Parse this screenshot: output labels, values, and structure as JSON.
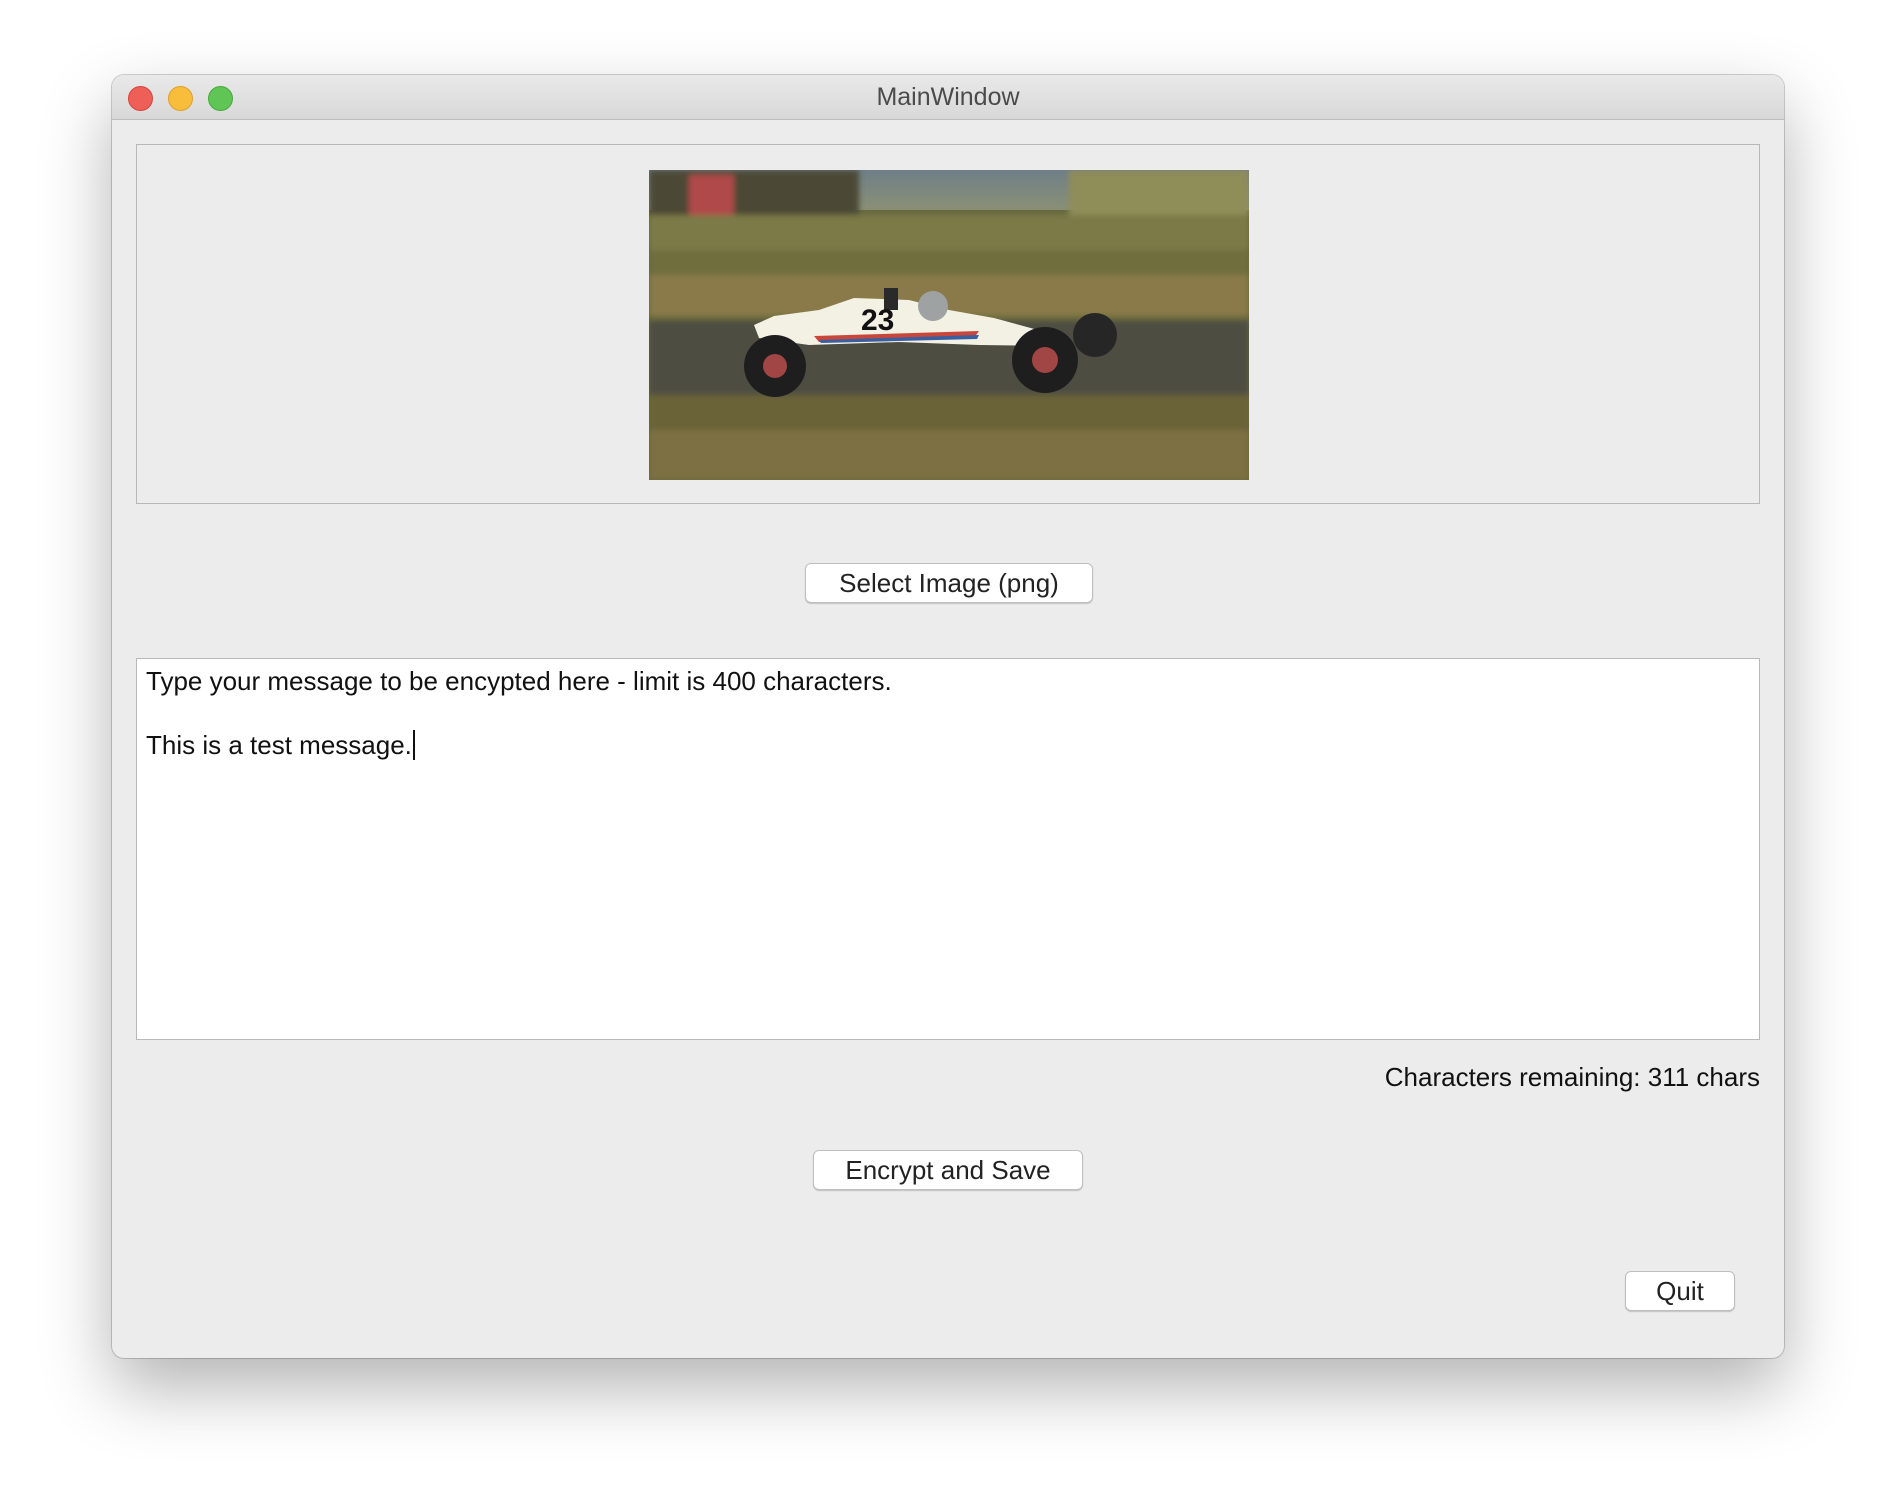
{
  "window": {
    "title": "MainWindow"
  },
  "image_preview": {
    "description_icon": "race-car-photo"
  },
  "buttons": {
    "select_image": "Select Image (png)",
    "encrypt_save": "Encrypt and Save",
    "quit": "Quit"
  },
  "message": {
    "line1": "Type your message to be encypted here - limit is 400 characters.",
    "line2": "This is a test message."
  },
  "status": {
    "remaining": "Characters remaining: 311 chars"
  },
  "photo_overlay": {
    "car_number": "23"
  },
  "colors": {
    "window_bg": "#ececec",
    "close": "#ee5f58",
    "minimize": "#f8bd3a",
    "maximize": "#5fc554"
  }
}
